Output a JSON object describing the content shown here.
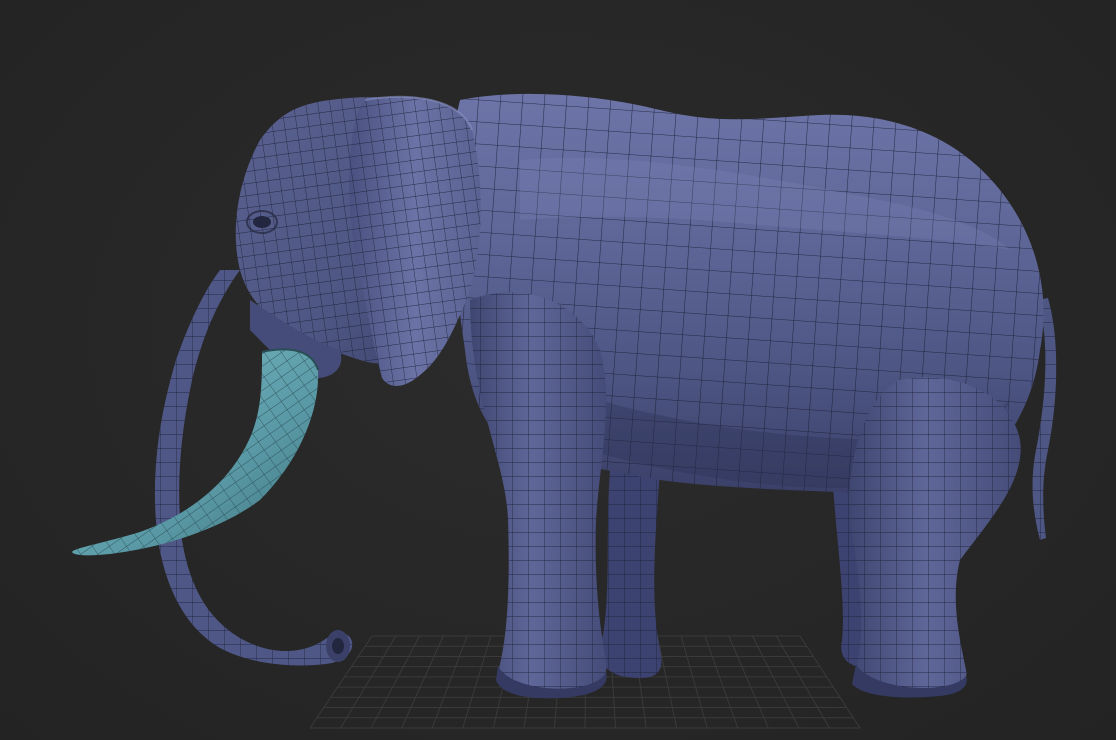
{
  "viewport": {
    "background_color": "#262626",
    "floor_grid_color": "#3a3a3a",
    "floor_grid_visible": true
  },
  "model": {
    "subject": "elephant",
    "body_color": "#5a6190",
    "body_highlight": "#7880b3",
    "body_shadow": "#2f3458",
    "wire_color": "#1b1f35",
    "tusk_color": "#5a9aa6",
    "tusk_highlight": "#79bcc6",
    "wireframe_visible": true
  }
}
